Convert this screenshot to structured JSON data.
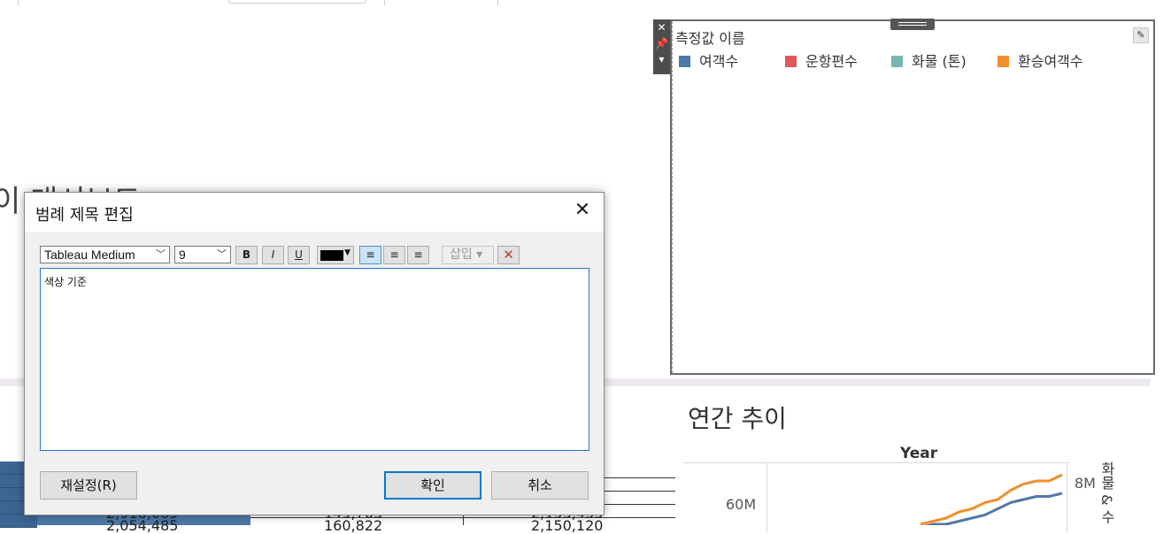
{
  "dashboard": {
    "title_partial": "이 대시보드"
  },
  "legend": {
    "title": "측정값 이름",
    "edit_icon": "pen-icon",
    "tools": [
      "close-icon",
      "pin-icon",
      "dropdown-icon"
    ],
    "items": [
      {
        "label": "여객수",
        "color": "#4e79a7"
      },
      {
        "label": "운항편수",
        "color": "#e15759"
      },
      {
        "label": "화물 (톤)",
        "color": "#76b7b2"
      },
      {
        "label": "환승여객수",
        "color": "#f28e2b"
      }
    ]
  },
  "trend": {
    "title": "연간 추이",
    "x_header": "Year",
    "left_tick": "60M",
    "right_tick": "8M",
    "right_axis_label": "화물 & 수"
  },
  "table": {
    "rows": [
      [
        "2,918,089",
        "149,763",
        "2,153,433"
      ],
      [
        "2,054,485",
        "160,822",
        "2,150,120"
      ]
    ]
  },
  "dialog": {
    "title": "범례 제목 편집",
    "font_name": "Tableau Medium",
    "font_size": "9",
    "bold": "B",
    "italic": "I",
    "underline": "U",
    "text_color": "#000000",
    "align_left_icon": "align-left-icon",
    "align_center_icon": "align-center-icon",
    "align_right_icon": "align-right-icon",
    "insert_label": "삽입",
    "delete_icon": "delete-x-icon",
    "editor_text": "색상 기준",
    "reset_label": "재설정(R)",
    "ok_label": "확인",
    "cancel_label": "취소"
  },
  "chart_data": {
    "type": "line",
    "x": [
      1,
      2,
      3,
      4,
      5,
      6,
      7,
      8,
      9,
      10,
      11,
      12
    ],
    "series": [
      {
        "values": [
          50,
          51,
          52,
          54,
          55,
          57,
          58,
          61,
          63,
          64,
          64,
          66
        ],
        "color": "#f28e2b"
      },
      {
        "values": [
          49,
          50,
          50,
          51,
          52,
          53,
          55,
          57,
          58,
          59,
          59,
          60
        ],
        "color": "#4e79a7"
      }
    ],
    "ylim": [
      48,
      68
    ]
  }
}
